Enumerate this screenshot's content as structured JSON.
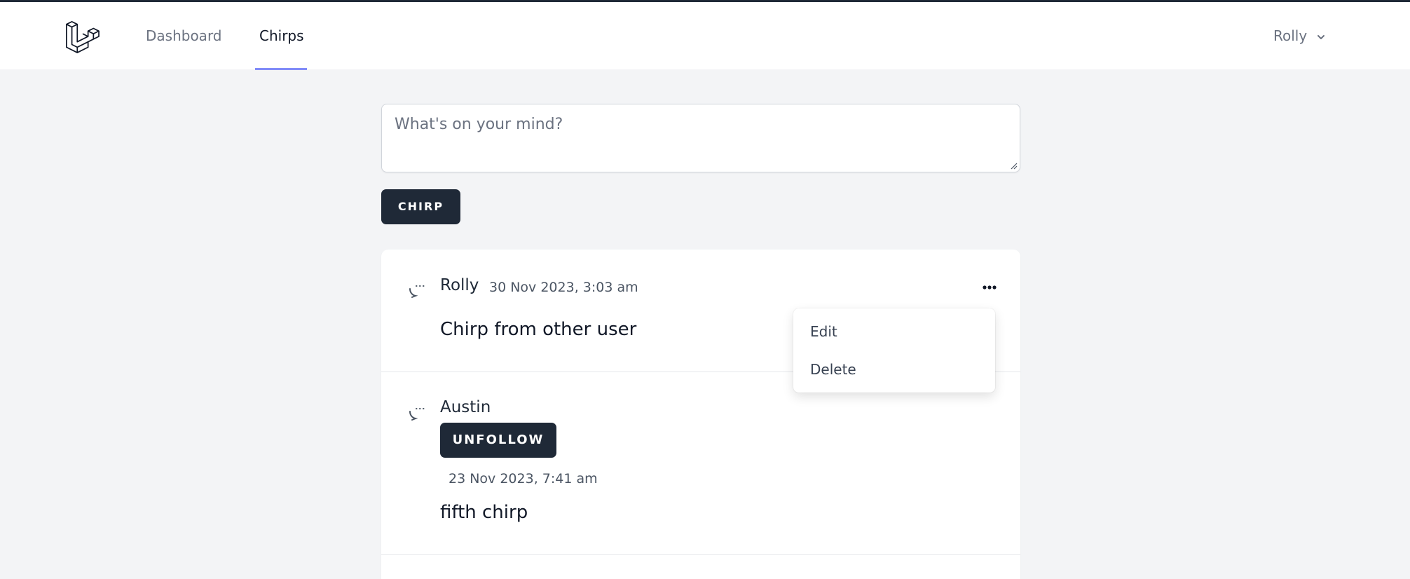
{
  "nav": {
    "links": [
      {
        "label": "Dashboard",
        "active": false
      },
      {
        "label": "Chirps",
        "active": true
      }
    ],
    "user_name": "Rolly",
    "active_underline_color": "#818cf8"
  },
  "composer": {
    "placeholder": "What's on your mind?",
    "value": "",
    "submit_label": "Chirp"
  },
  "chirps": [
    {
      "author": "Rolly",
      "timestamp": "30 Nov 2023, 3:03 am",
      "message": "Chirp from other user",
      "menu_open": true,
      "menu_items": [
        "Edit",
        "Delete"
      ]
    },
    {
      "author": "Austin",
      "follow_button_label": "Unfollow",
      "timestamp": "23 Nov 2023, 7:41 am",
      "message": "fifth chirp"
    }
  ],
  "colors": {
    "dark_button": "#1f2937",
    "page_background": "#f3f4f6"
  }
}
